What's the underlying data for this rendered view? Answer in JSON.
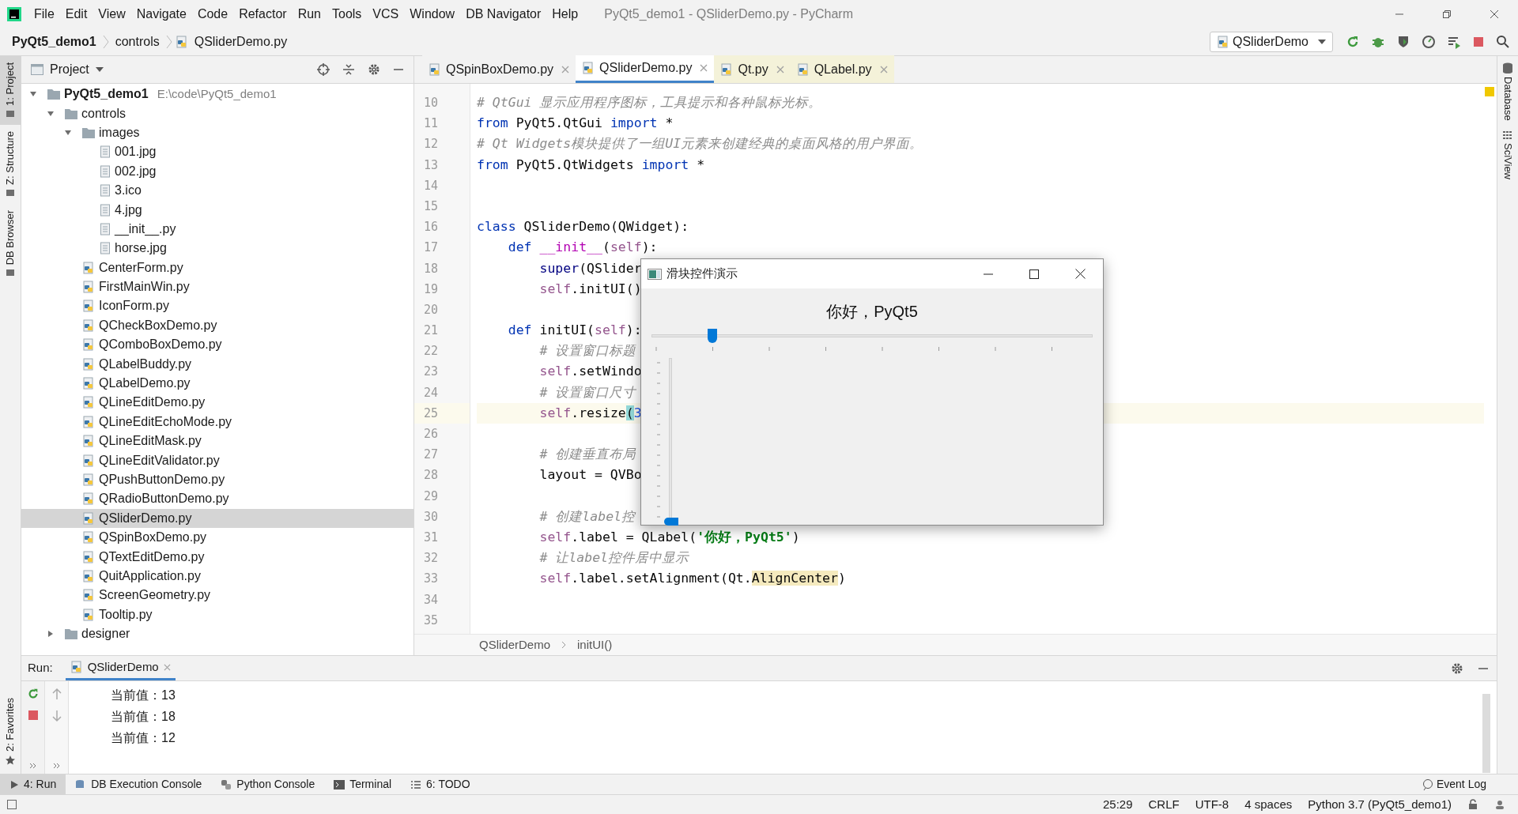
{
  "menu_bar": {
    "items": [
      "File",
      "Edit",
      "View",
      "Navigate",
      "Code",
      "Refactor",
      "Run",
      "Tools",
      "VCS",
      "Window",
      "DB Navigator",
      "Help"
    ],
    "title": "PyQt5_demo1 - QSliderDemo.py - PyCharm"
  },
  "navigation_bar": {
    "breadcrumbs": [
      "PyQt5_demo1",
      "controls",
      "QSliderDemo.py"
    ],
    "run_configuration": "QSliderDemo"
  },
  "left_stripe": [
    {
      "label": "1: Project",
      "selected": true
    },
    {
      "label": "Z: Structure",
      "selected": false
    },
    {
      "label": "DB Browser",
      "selected": false
    }
  ],
  "project_panel": {
    "title": "Project",
    "tree": [
      {
        "label": "PyQt5_demo1",
        "path": "E:\\code\\PyQt5_demo1",
        "kind": "folder",
        "expanded": true,
        "selected": false,
        "children": [
          {
            "label": "controls",
            "kind": "folder",
            "expanded": true,
            "selected": false,
            "children": [
              {
                "label": "images",
                "kind": "folder",
                "expanded": true,
                "selected": false,
                "children": [
                  {
                    "label": "001.jpg",
                    "kind": "file",
                    "selected": false
                  },
                  {
                    "label": "002.jpg",
                    "kind": "file",
                    "selected": false
                  },
                  {
                    "label": "3.ico",
                    "kind": "file",
                    "selected": false
                  },
                  {
                    "label": "4.jpg",
                    "kind": "file",
                    "selected": false
                  },
                  {
                    "label": "__init__.py",
                    "kind": "file",
                    "selected": false
                  },
                  {
                    "label": "horse.jpg",
                    "kind": "file",
                    "selected": false
                  }
                ]
              },
              {
                "label": "CenterForm.py",
                "kind": "python",
                "selected": false
              },
              {
                "label": "FirstMainWin.py",
                "kind": "python",
                "selected": false
              },
              {
                "label": "IconForm.py",
                "kind": "python",
                "selected": false
              },
              {
                "label": "QCheckBoxDemo.py",
                "kind": "python",
                "selected": false
              },
              {
                "label": "QComboBoxDemo.py",
                "kind": "python",
                "selected": false
              },
              {
                "label": "QLabelBuddy.py",
                "kind": "python",
                "selected": false
              },
              {
                "label": "QLabelDemo.py",
                "kind": "python",
                "selected": false
              },
              {
                "label": "QLineEditDemo.py",
                "kind": "python",
                "selected": false
              },
              {
                "label": "QLineEditEchoMode.py",
                "kind": "python",
                "selected": false
              },
              {
                "label": "QLineEditMask.py",
                "kind": "python",
                "selected": false
              },
              {
                "label": "QLineEditValidator.py",
                "kind": "python",
                "selected": false
              },
              {
                "label": "QPushButtonDemo.py",
                "kind": "python",
                "selected": false
              },
              {
                "label": "QRadioButtonDemo.py",
                "kind": "python",
                "selected": false
              },
              {
                "label": "QSliderDemo.py",
                "kind": "python",
                "selected": true
              },
              {
                "label": "QSpinBoxDemo.py",
                "kind": "python",
                "selected": false
              },
              {
                "label": "QTextEditDemo.py",
                "kind": "python",
                "selected": false
              },
              {
                "label": "QuitApplication.py",
                "kind": "python",
                "selected": false
              },
              {
                "label": "ScreenGeometry.py",
                "kind": "python",
                "selected": false
              },
              {
                "label": "Tooltip.py",
                "kind": "python",
                "selected": false
              }
            ]
          },
          {
            "label": "designer",
            "kind": "folder",
            "expanded": false,
            "selected": false
          }
        ]
      }
    ]
  },
  "editor_tabs": [
    {
      "label": "QSpinBoxDemo.py",
      "selected": false,
      "kind": "project"
    },
    {
      "label": "QSliderDemo.py",
      "selected": true,
      "kind": "project"
    },
    {
      "label": "Qt.py",
      "selected": false,
      "kind": "library"
    },
    {
      "label": "QLabel.py",
      "selected": false,
      "kind": "library"
    }
  ],
  "editor": {
    "lines": [
      {
        "number": "10",
        "current": false,
        "kind": "top",
        "tokens": [
          {
            "kind": "comment",
            "text": "# QtGui 显示应用程序图标，工具提示和各种鼠标光标。"
          }
        ]
      },
      {
        "number": "11",
        "current": false,
        "kind": "top",
        "tokens": [
          {
            "kind": "keyword",
            "text": "from"
          },
          {
            "kind": "plain",
            "text": " PyQt5.QtGui "
          },
          {
            "kind": "keyword",
            "text": "import"
          },
          {
            "kind": "plain",
            "text": " *"
          }
        ]
      },
      {
        "number": "12",
        "current": false,
        "kind": "top",
        "tokens": [
          {
            "kind": "comment",
            "text": "# Qt Widgets模块提供了一组UI元素来创建经典的桌面风格的用户界面。"
          }
        ]
      },
      {
        "number": "13",
        "current": false,
        "kind": "top",
        "tokens": [
          {
            "kind": "keyword",
            "text": "from"
          },
          {
            "kind": "plain",
            "text": " PyQt5.QtWidgets "
          },
          {
            "kind": "keyword",
            "text": "import"
          },
          {
            "kind": "plain",
            "text": " *"
          }
        ]
      },
      {
        "number": "14",
        "current": false,
        "kind": "top"
      },
      {
        "number": "15",
        "current": false,
        "kind": "top"
      },
      {
        "number": "16",
        "current": false,
        "kind": "top",
        "tokens": [
          {
            "kind": "keyword",
            "text": "class"
          },
          {
            "kind": "plain",
            "text": " QSliderDemo(QWidget):"
          }
        ]
      },
      {
        "number": "17",
        "current": false,
        "kind": "member",
        "tokens": [
          {
            "kind": "keyword",
            "text": "def"
          },
          {
            "kind": "dunder",
            "text": " __init__"
          },
          {
            "kind": "plain",
            "text": "("
          },
          {
            "kind": "self",
            "text": "self"
          },
          {
            "kind": "plain",
            "text": "):"
          }
        ]
      },
      {
        "number": "18",
        "current": false,
        "kind": "statement",
        "tokens": [
          {
            "kind": "builtin",
            "text": "super"
          },
          {
            "kind": "plain",
            "text": "(QSlider"
          }
        ]
      },
      {
        "number": "19",
        "current": false,
        "kind": "statement",
        "tokens": [
          {
            "kind": "self",
            "text": "self"
          },
          {
            "kind": "plain",
            "text": ".initUI()"
          }
        ]
      },
      {
        "number": "20",
        "current": false,
        "kind": "top"
      },
      {
        "number": "21",
        "current": false,
        "kind": "member",
        "tokens": [
          {
            "kind": "keyword",
            "text": "def"
          },
          {
            "kind": "plain",
            "text": " initUI("
          },
          {
            "kind": "self",
            "text": "self"
          },
          {
            "kind": "plain",
            "text": "):"
          }
        ]
      },
      {
        "number": "22",
        "current": false,
        "kind": "statement",
        "tokens": [
          {
            "kind": "comment",
            "text": "# 设置窗口标题"
          }
        ]
      },
      {
        "number": "23",
        "current": false,
        "kind": "statement",
        "tokens": [
          {
            "kind": "self",
            "text": "self"
          },
          {
            "kind": "plain",
            "text": ".setWindo"
          }
        ]
      },
      {
        "number": "24",
        "current": false,
        "kind": "statement",
        "tokens": [
          {
            "kind": "comment",
            "text": "# 设置窗口尺寸"
          }
        ]
      },
      {
        "number": "25",
        "current": true,
        "kind": "statement",
        "tokens": [
          {
            "kind": "self",
            "text": "self"
          },
          {
            "kind": "plain",
            "text": ".resize"
          },
          {
            "kind": "brace",
            "text": "("
          },
          {
            "kind": "number",
            "text": "3"
          }
        ]
      },
      {
        "number": "26",
        "current": false,
        "kind": "top"
      },
      {
        "number": "27",
        "current": false,
        "kind": "statement",
        "tokens": [
          {
            "kind": "comment",
            "text": "# 创建垂直布局"
          }
        ]
      },
      {
        "number": "28",
        "current": false,
        "kind": "statement",
        "tokens": [
          {
            "kind": "plain",
            "text": "layout = QVBo"
          }
        ]
      },
      {
        "number": "29",
        "current": false,
        "kind": "top"
      },
      {
        "number": "30",
        "current": false,
        "kind": "statement",
        "tokens": [
          {
            "kind": "comment",
            "text": "# 创建label控"
          }
        ]
      },
      {
        "number": "31",
        "current": false,
        "kind": "statement",
        "tokens": [
          {
            "kind": "self",
            "text": "self"
          },
          {
            "kind": "plain",
            "text": ".label = QLabel("
          },
          {
            "kind": "string",
            "text": "'你好，PyQt5'"
          },
          {
            "kind": "plain",
            "text": ")"
          }
        ]
      },
      {
        "number": "32",
        "current": false,
        "kind": "statement",
        "tokens": [
          {
            "kind": "comment",
            "text": "# 让label控件居中显示"
          }
        ]
      },
      {
        "number": "33",
        "current": false,
        "kind": "statement",
        "tokens": [
          {
            "kind": "self",
            "text": "self"
          },
          {
            "kind": "plain",
            "text": ".label.setAlignment(Qt."
          },
          {
            "kind": "highlight",
            "text": "AlignCenter"
          },
          {
            "kind": "plain",
            "text": ")"
          }
        ]
      },
      {
        "number": "34",
        "current": false,
        "kind": "top"
      },
      {
        "number": "35",
        "current": false,
        "kind": "top"
      }
    ],
    "breadcrumbs": [
      "QSliderDemo",
      "initUI()"
    ]
  },
  "dialog": {
    "title": "滑块控件演示",
    "label": "你好，PyQt5",
    "horizontal_slider": {
      "level": 0.13
    },
    "vertical_slider": {
      "level": 0
    }
  },
  "run_panel": {
    "label": "Run:",
    "tab": "QSliderDemo",
    "output": [
      "当前值：13",
      "当前值：18",
      "当前值：12"
    ]
  },
  "favorites_stripe": "2: Favorites",
  "right_stripe": [
    "Database",
    "SciView"
  ],
  "tool_tabs": [
    {
      "label": "4: Run",
      "selected": true,
      "kind": "run"
    },
    {
      "label": "DB Execution Console",
      "selected": false,
      "kind": "db"
    },
    {
      "label": "Python Console",
      "selected": false,
      "kind": "python"
    },
    {
      "label": "Terminal",
      "selected": false,
      "kind": "terminal"
    },
    {
      "label": "6: TODO",
      "selected": false,
      "kind": "todo"
    }
  ],
  "event_log": "Event Log",
  "status_bar": [
    "25:29",
    "CRLF",
    "UTF-8",
    "4 spaces",
    "Python 3.7 (PyQt5_demo1)"
  ]
}
